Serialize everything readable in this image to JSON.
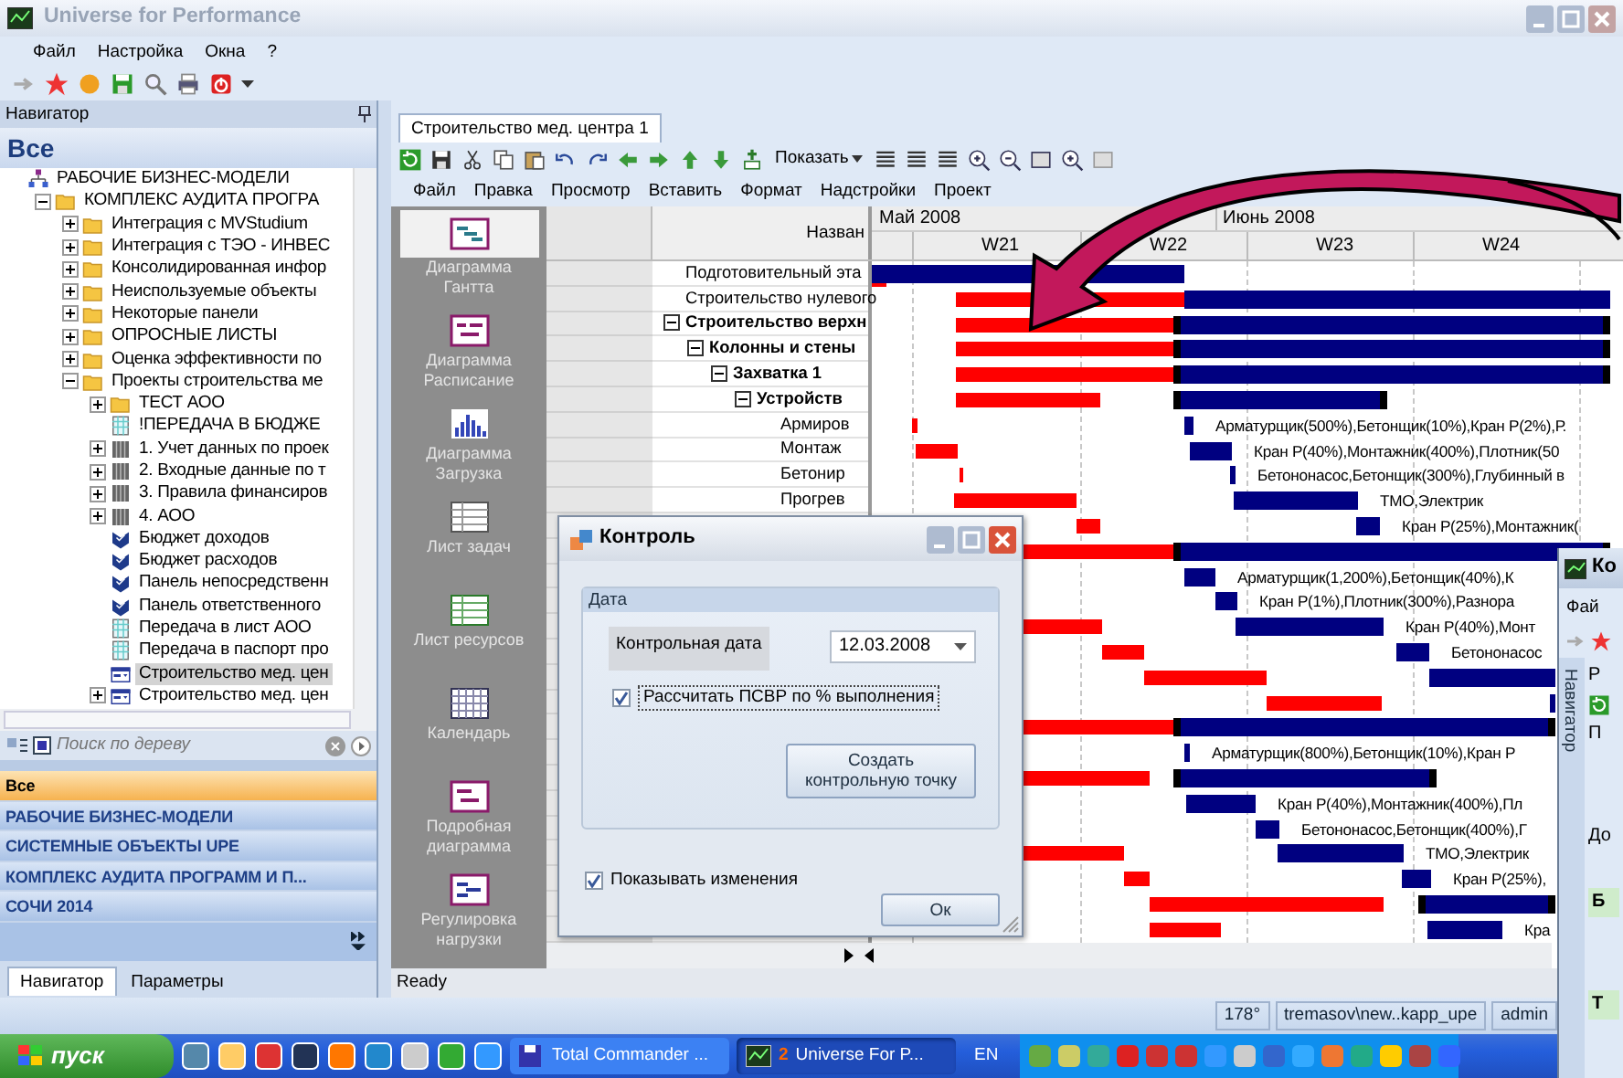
{
  "window": {
    "title": "Universe for Performance"
  },
  "menu": [
    "Файл",
    "Настройка",
    "Окна",
    "?"
  ],
  "navigator": {
    "title": "Навигатор",
    "heading": "Все",
    "tree": [
      {
        "label": "РАБОЧИЕ БИЗНЕС-МОДЕЛИ",
        "kind": "model",
        "selected": false,
        "children": [
          {
            "label": "КОМПЛЕКС АУДИТА ПРОГРА",
            "kind": "folder",
            "expanded": true,
            "selected": false,
            "children": [
              {
                "label": "Интеграция с MVStudium",
                "kind": "folder",
                "expanded": false,
                "selected": false
              },
              {
                "label": "Интеграция с ТЭО - ИНВЕС",
                "kind": "folder",
                "expanded": false,
                "selected": false
              },
              {
                "label": "Консолидированная инфор",
                "kind": "folder",
                "expanded": false,
                "selected": false
              },
              {
                "label": "Неиспользуемые объекты",
                "kind": "folder",
                "expanded": false,
                "selected": false
              },
              {
                "label": "Некоторые панели",
                "kind": "folder",
                "expanded": false,
                "selected": false
              },
              {
                "label": "ОПРОСНЫЕ ЛИСТЫ",
                "kind": "folder",
                "expanded": false,
                "selected": false
              },
              {
                "label": "Оценка эффективности по",
                "kind": "folder",
                "expanded": false,
                "selected": false
              },
              {
                "label": "Проекты строительства ме",
                "kind": "folder",
                "expanded": true,
                "selected": false,
                "children": [
                  {
                    "label": "ТЕСТ АОО",
                    "kind": "folder",
                    "expanded": false,
                    "selected": false
                  },
                  {
                    "label": "!ПЕРЕДАЧА В БЮДЖЕ",
                    "kind": "sheet",
                    "selected": false
                  },
                  {
                    "label": "1. Учет данных по проек",
                    "kind": "table",
                    "expanded": false,
                    "selected": false
                  },
                  {
                    "label": "2. Входные данные по т",
                    "kind": "table",
                    "expanded": false,
                    "selected": false
                  },
                  {
                    "label": "3. Правила финансиров",
                    "kind": "table",
                    "expanded": false,
                    "selected": false
                  },
                  {
                    "label": "4. АОО",
                    "kind": "table",
                    "expanded": false,
                    "selected": false
                  },
                  {
                    "label": "Бюджет доходов",
                    "kind": "panel",
                    "selected": false
                  },
                  {
                    "label": "Бюджет расходов",
                    "kind": "panel",
                    "selected": false
                  },
                  {
                    "label": "Панель непосредственн",
                    "kind": "panel",
                    "selected": false
                  },
                  {
                    "label": "Панель ответственного",
                    "kind": "panel",
                    "selected": false
                  },
                  {
                    "label": "Передача в лист АОО",
                    "kind": "sheet",
                    "selected": false
                  },
                  {
                    "label": "Передача в паспорт про",
                    "kind": "sheet",
                    "selected": false
                  },
                  {
                    "label": "Строительство мед. цен",
                    "kind": "form",
                    "selected": true
                  },
                  {
                    "label": "Строительство мед. цен",
                    "kind": "form",
                    "expanded": false,
                    "selected": false
                  }
                ]
              }
            ]
          }
        ]
      }
    ],
    "search": {
      "placeholder": "Поиск по дереву"
    },
    "categories": [
      {
        "label": "Все",
        "selected": true
      },
      {
        "label": "РАБОЧИЕ БИЗНЕС-МОДЕЛИ",
        "selected": false
      },
      {
        "label": "СИСТЕМНЫЕ ОБЪЕКТЫ UPE",
        "selected": false
      },
      {
        "label": "КОМПЛЕКС АУДИТА ПРОГРАММ И П...",
        "selected": false
      },
      {
        "label": "СОЧИ 2014",
        "selected": false
      }
    ],
    "tabs": [
      {
        "label": "Навигатор",
        "selected": true
      },
      {
        "label": "Параметры",
        "selected": false
      }
    ]
  },
  "document": {
    "tab": {
      "label": "Строительство мед. центра 1",
      "selected": true
    },
    "show_button": "Показать",
    "menu": [
      "Файл",
      "Правка",
      "Просмотр",
      "Вставить",
      "Формат",
      "Надстройки",
      "Проект"
    ],
    "views": [
      {
        "label": "Диаграмма Гантта",
        "kind": "gantt",
        "selected": true
      },
      {
        "label": "Диаграмма Расписание",
        "kind": "schedule",
        "selected": false
      },
      {
        "label": "Диаграмма Загрузка",
        "kind": "load",
        "selected": false
      },
      {
        "label": "Лист задач",
        "kind": "tasks",
        "selected": false
      },
      {
        "label": "Лист ресурсов",
        "kind": "resources",
        "selected": false
      },
      {
        "label": "Календарь",
        "kind": "calendar",
        "selected": false
      },
      {
        "label": "Подробная диаграмма",
        "kind": "detail",
        "selected": false
      },
      {
        "label": "Регулировка нагрузки",
        "kind": "leveling",
        "selected": false
      }
    ],
    "name_column": "Назван",
    "tasks": [
      {
        "name": "Подготовительный эта",
        "kind": "task"
      },
      {
        "name": "Строительство нулевого",
        "kind": "task"
      },
      {
        "name": "Строительство верхн",
        "kind": "summary",
        "expanded": true,
        "children": [
          {
            "name": "Колонны и стены",
            "kind": "summary",
            "expanded": true,
            "children": [
              {
                "name": "Захватка 1",
                "kind": "summary",
                "expanded": true,
                "children": [
                  {
                    "name": "Устройств",
                    "kind": "summary",
                    "expanded": true,
                    "children": [
                      {
                        "name": "Армиров",
                        "kind": "task"
                      },
                      {
                        "name": "Монтаж",
                        "kind": "task"
                      },
                      {
                        "name": "Бетонир",
                        "kind": "task"
                      },
                      {
                        "name": "Прогрев",
                        "kind": "task"
                      }
                    ]
                  }
                ]
              }
            ]
          }
        ]
      }
    ],
    "months": [
      "Май 2008",
      "Июнь 2008"
    ],
    "weeks": [
      "W21",
      "W22",
      "W23",
      "W24"
    ],
    "bars": [
      {
        "kind": "task"
      },
      {
        "kind": "task"
      },
      {
        "kind": "summary"
      },
      {
        "kind": "summary"
      },
      {
        "kind": "summary"
      },
      {
        "kind": "summary"
      },
      {
        "kind": "task",
        "resources": "Арматурщик(500%),Бетонщик(10%),Кран Р(2%),Р."
      },
      {
        "kind": "task",
        "resources": "Кран Р(40%),Монтажник(400%),Плотник(50"
      },
      {
        "kind": "task",
        "resources": "Бетононасос,Бетонщик(300%),Глубинный в"
      },
      {
        "kind": "task",
        "resources": "ТМО,Электрик"
      },
      {
        "kind": "task",
        "resources": "Кран Р(25%),Монтажник("
      },
      {
        "kind": "summary"
      },
      {
        "kind": "task",
        "resources": "Арматурщик(1,200%),Бетонщик(40%),К"
      },
      {
        "kind": "task",
        "resources": "Кран Р(1%),Плотник(300%),Разнора"
      },
      {
        "kind": "task",
        "resources": "Кран Р(40%),Монт"
      },
      {
        "kind": "task",
        "resources": "Бетононасос"
      },
      {
        "kind": "task"
      },
      {
        "kind": "task"
      },
      {
        "kind": "summary"
      },
      {
        "kind": "task",
        "resources": "Арматурщик(800%),Бетонщик(10%),Кран Р"
      },
      {
        "kind": "summary"
      },
      {
        "kind": "task",
        "resources": "Кран Р(40%),Монтажник(400%),Пл"
      },
      {
        "kind": "task",
        "resources": "Бетононасос,Бетонщик(400%),Г"
      },
      {
        "kind": "task",
        "resources": "ТМО,Электрик"
      },
      {
        "kind": "task",
        "resources": "Кран Р(25%),"
      },
      {
        "kind": "summary"
      },
      {
        "kind": "task",
        "resources": "Кра"
      }
    ],
    "status": "Ready"
  },
  "status_bar": [
    "178°",
    "tremasov\\new..kapp_upe",
    "admin"
  ],
  "dialog": {
    "title": "Контроль",
    "group": "Дата",
    "date_label": "Контрольная дата",
    "date_value": "12.03.2008",
    "recalc": {
      "label": "Рассчитать ПСВР по % выполнения",
      "checked": true
    },
    "create_button": "Создать контрольную точку",
    "show_changes": {
      "label": "Показывать изменения",
      "checked": true
    },
    "ok_button": "Ок"
  },
  "second_window": {
    "title": "Ко",
    "menu": "Фай",
    "side_tab": "Навигатор",
    "tab": "Р",
    "field": "П",
    "label": "До",
    "row_1": "Б",
    "row_2": "Т"
  },
  "taskbar": {
    "start": "пуск",
    "tasks": [
      {
        "label": "Total Commander ...",
        "selected": false
      },
      {
        "badge": "2",
        "label": "Universe For P...",
        "selected": true
      }
    ],
    "language": "EN"
  }
}
